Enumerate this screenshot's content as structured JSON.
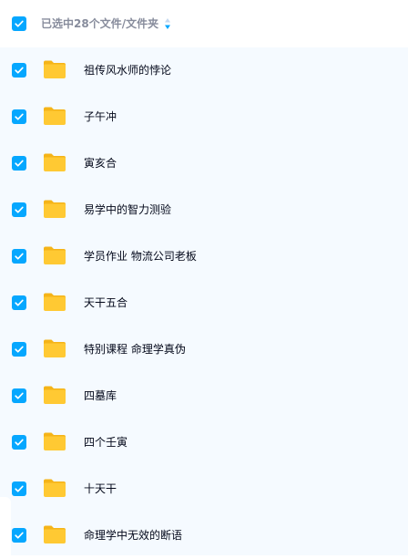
{
  "header": {
    "selection_label": "已选中28个文件/文件夹",
    "checkbox_checked": true,
    "sort_icon": "sort-arrows-icon"
  },
  "colors": {
    "accent": "#06a7ff",
    "folder": "#ffc933",
    "list_background": "#f5faff",
    "text": "#03081a",
    "muted_text": "#878c9c"
  },
  "files": [
    {
      "name": "祖传风水师的悖论",
      "checked": true,
      "icon": "folder-icon"
    },
    {
      "name": "子午冲",
      "checked": true,
      "icon": "folder-icon"
    },
    {
      "name": "寅亥合",
      "checked": true,
      "icon": "folder-icon"
    },
    {
      "name": "易学中的智力测验",
      "checked": true,
      "icon": "folder-icon"
    },
    {
      "name": "学员作业 物流公司老板",
      "checked": true,
      "icon": "folder-icon"
    },
    {
      "name": "天干五合",
      "checked": true,
      "icon": "folder-icon"
    },
    {
      "name": "特别课程 命理学真伪",
      "checked": true,
      "icon": "folder-icon"
    },
    {
      "name": "四墓库",
      "checked": true,
      "icon": "folder-icon"
    },
    {
      "name": "四个壬寅",
      "checked": true,
      "icon": "folder-icon"
    },
    {
      "name": "十天干",
      "checked": true,
      "icon": "folder-icon"
    },
    {
      "name": "命理学中无效的断语",
      "checked": true,
      "icon": "folder-icon"
    }
  ]
}
